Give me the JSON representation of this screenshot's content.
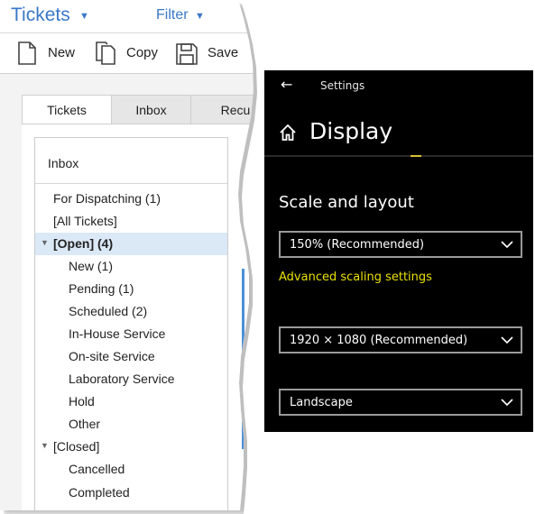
{
  "ticket_app": {
    "title": "Tickets",
    "filter_label": "Filter",
    "toolbar": {
      "new_label": "New",
      "copy_label": "Copy",
      "save_label": "Save"
    },
    "tabs": [
      "Tickets",
      "Inbox",
      "Recu"
    ],
    "tree": {
      "header": "Inbox",
      "rows": [
        {
          "label": "For Dispatching (1)"
        },
        {
          "label": "[All Tickets]"
        },
        {
          "label": "[Open]  (4)"
        },
        {
          "label": "New (1)"
        },
        {
          "label": "Pending (1)"
        },
        {
          "label": "Scheduled (2)"
        },
        {
          "label": "In-House Service"
        },
        {
          "label": "On-site Service"
        },
        {
          "label": "Laboratory Service"
        },
        {
          "label": "Hold"
        },
        {
          "label": "Other"
        },
        {
          "label": "[Closed]"
        },
        {
          "label": "Cancelled"
        },
        {
          "label": "Completed"
        }
      ]
    },
    "colors": {
      "accent": "#3a78c8",
      "selected_row": "#dbe8f6"
    }
  },
  "settings": {
    "window_title": "Settings",
    "page_heading": "Display",
    "section_title": "Scale and layout",
    "scale_value": "150% (Recommended)",
    "advanced_link": "Advanced scaling settings",
    "resolution_value": "1920 × 1080 (Recommended)",
    "orientation_value": "Landscape",
    "colors": {
      "background": "#000000",
      "link": "#e8e000"
    }
  }
}
